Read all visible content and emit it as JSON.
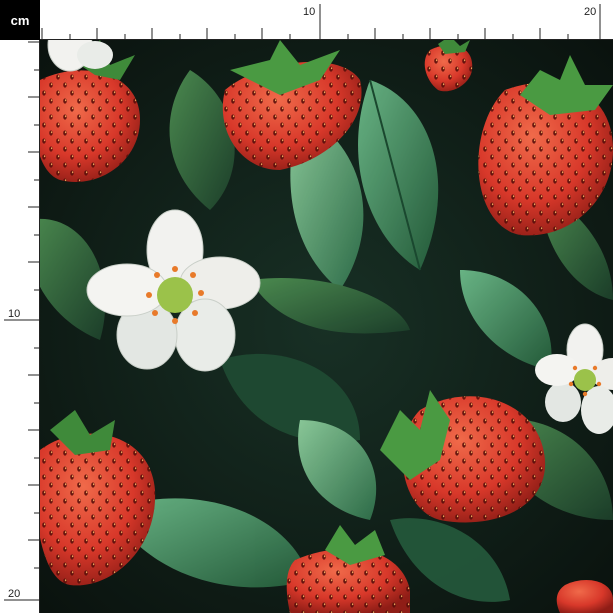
{
  "ruler": {
    "unit": "cm",
    "top_labels": [
      "10",
      "20"
    ],
    "left_labels": [
      "10",
      "20"
    ]
  },
  "pattern": {
    "motifs": [
      "strawberry",
      "white-flower",
      "leaf"
    ],
    "colors": {
      "background": "#0f1a14",
      "strawberry": "#d8382a",
      "leaf": "#3f8a5a",
      "flower": "#f2f2ef",
      "flower_center": "#9bc24a"
    }
  }
}
